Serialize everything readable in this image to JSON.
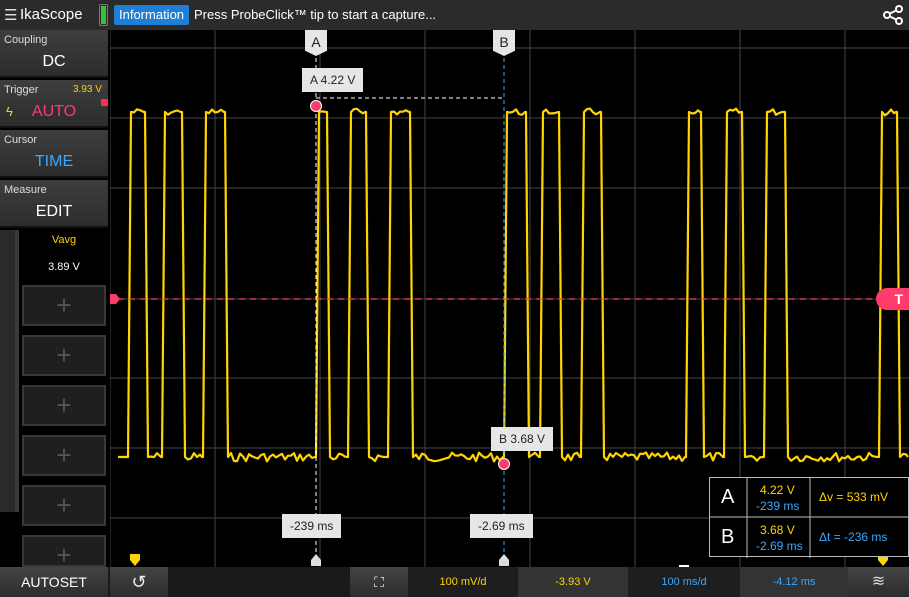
{
  "topbar": {
    "menu_icon": "hamburger-menu-icon",
    "title": "IkaScope",
    "battery_icon": "battery-icon",
    "info_badge": "Information",
    "info_message": "Press ProbeClick™ tip to start a capture...",
    "share_icon": "share-icon"
  },
  "sidebar": {
    "coupling": {
      "label": "Coupling",
      "value": "DC"
    },
    "trigger": {
      "label": "Trigger",
      "value": "AUTO",
      "level": "3.93 V",
      "icon": "lightning-bolt-icon"
    },
    "cursor": {
      "label": "Cursor",
      "value": "TIME"
    },
    "measure": {
      "label": "Measure",
      "value": "EDIT"
    },
    "measurement": {
      "label": "Vavg",
      "value": "3.89 V"
    },
    "slots": [
      "+",
      "+",
      "+",
      "+",
      "+",
      "+"
    ]
  },
  "cursors": {
    "a": {
      "flag": "A",
      "readout": "A  4.22 V",
      "time": "-239 ms"
    },
    "b": {
      "flag": "B",
      "readout": "B  3.68 V",
      "time": "-2.69 ms"
    }
  },
  "trigger_marker": "T",
  "delta": {
    "a_name": "A",
    "a_volt": "4.22 V",
    "a_time": "-239 ms",
    "b_name": "B",
    "b_volt": "3.68 V",
    "b_time": "-2.69 ms",
    "dv": "Δv = 533 mV",
    "dt": "Δt = -236 ms"
  },
  "bottombar": {
    "autoset": "AUTOSET",
    "history_icon": "history-icon",
    "zoom_icon": "fit-screen-icon",
    "volts_per_div": "100 mV/d",
    "volt_offset": "-3.93 V",
    "time_per_div": "100 ms/d",
    "time_offset": "-4.12 ms",
    "probe_icon": "probe-settings-icon"
  },
  "colors": {
    "trace": "#ffd400",
    "trigger": "#ff3b6b",
    "cursor_b": "#3aa8ff",
    "info": "#1e7fd4"
  }
}
